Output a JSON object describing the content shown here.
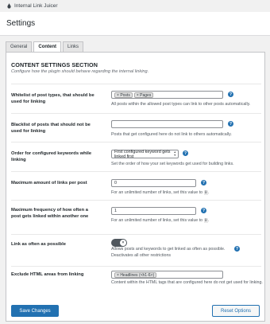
{
  "app": {
    "name": "Internal Link Juicer",
    "page_title": "Settings"
  },
  "tabs": [
    {
      "label": "General",
      "active": false
    },
    {
      "label": "Content",
      "active": true
    },
    {
      "label": "Links",
      "active": false
    }
  ],
  "section": {
    "title": "CONTENT SETTINGS SECTION",
    "subtitle": "Configure how the plugin should behave regarding the internal linking."
  },
  "settings": {
    "whitelist": {
      "label": "Whitelist of post types, that should be used for linking",
      "chips": [
        "Posts",
        "Pages"
      ],
      "description": "All posts within the allowed post types can link to other posts automatically."
    },
    "blacklist": {
      "label": "Blacklist of posts that should not be used for linking",
      "value": "",
      "description": "Posts that get configured here do not link to others automatically."
    },
    "order": {
      "label": "Order for configured keywords while linking",
      "selected": "First configured keyword gets linked first",
      "description": "Set the order of how your set keywords get used for building links."
    },
    "max_links": {
      "label": "Maximum amount of links per post",
      "value": "0",
      "description": "For an unlimited number of links, set this value to",
      "code": "0",
      "suffix": "."
    },
    "max_frequency": {
      "label": "Maximum frequency of how often a post gets linked within another one",
      "value": "1",
      "description": "For an unlimited number of links, set this value to",
      "code": "0",
      "suffix": "."
    },
    "link_often": {
      "label": "Link as often as possible",
      "toggle_on": false,
      "description_line1": "Allows posts and keywords to get linked as often as possible.",
      "description_line2": "Deactivates all other restrictions"
    },
    "exclude_html": {
      "label": "Exclude HTML areas from linking",
      "chips": [
        "Headlines (<h1-6>)"
      ],
      "description": "Content within the HTML tags that are configured here do not get used for linking."
    }
  },
  "buttons": {
    "save": "Save Changes",
    "reset": "Reset Options"
  }
}
